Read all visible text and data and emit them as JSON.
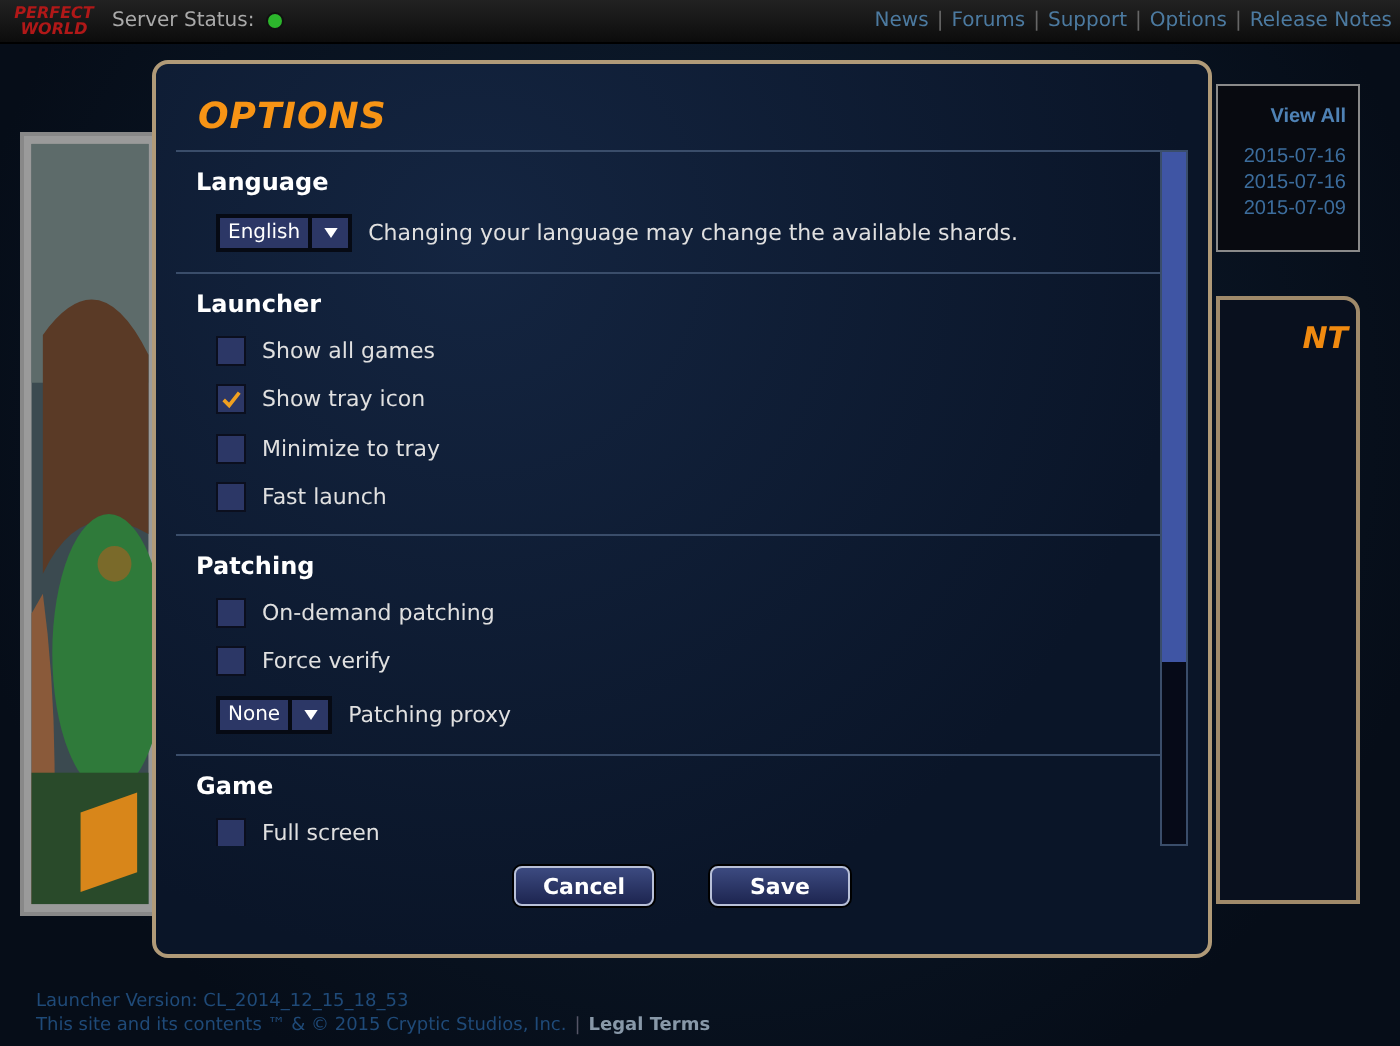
{
  "top_bar": {
    "logo": [
      "PERFECT",
      "WORLD"
    ],
    "server_status_label": "Server Status:",
    "server_online": true,
    "separator": "|",
    "links": [
      "News",
      "Forums",
      "Support",
      "Options",
      "Release Notes"
    ]
  },
  "news": {
    "view_all": "View All",
    "dates": [
      "2015-07-16",
      "2015-07-16",
      "2015-07-09"
    ]
  },
  "side_panel": {
    "heading": "NT"
  },
  "dialog": {
    "title": "OPTIONS",
    "sections": [
      {
        "title": "Language",
        "items": [
          {
            "kind": "dropdown",
            "value": "English",
            "note": "Changing your language may change the available shards."
          }
        ]
      },
      {
        "title": "Launcher",
        "items": [
          {
            "kind": "checkbox",
            "label": "Show all games",
            "checked": false
          },
          {
            "kind": "checkbox",
            "label": "Show tray icon",
            "checked": true
          },
          {
            "kind": "checkbox",
            "label": "Minimize to tray",
            "checked": false
          },
          {
            "kind": "checkbox",
            "label": "Fast launch",
            "checked": false
          }
        ]
      },
      {
        "title": "Patching",
        "items": [
          {
            "kind": "checkbox",
            "label": "On-demand patching",
            "checked": false
          },
          {
            "kind": "checkbox",
            "label": "Force verify",
            "checked": false
          },
          {
            "kind": "dropdown",
            "value": "None",
            "note": "Patching proxy"
          }
        ]
      },
      {
        "title": "Game",
        "items": [
          {
            "kind": "checkbox",
            "label": "Full screen",
            "checked": false
          }
        ]
      }
    ],
    "buttons": [
      "Cancel",
      "Save"
    ]
  },
  "footer": {
    "version": "Launcher Version: CL_2014_12_15_18_53",
    "copyright": "This site and its contents ™ & © 2015 Cryptic Studios, Inc.",
    "separator": "|",
    "legal_link": "Legal Terms"
  }
}
